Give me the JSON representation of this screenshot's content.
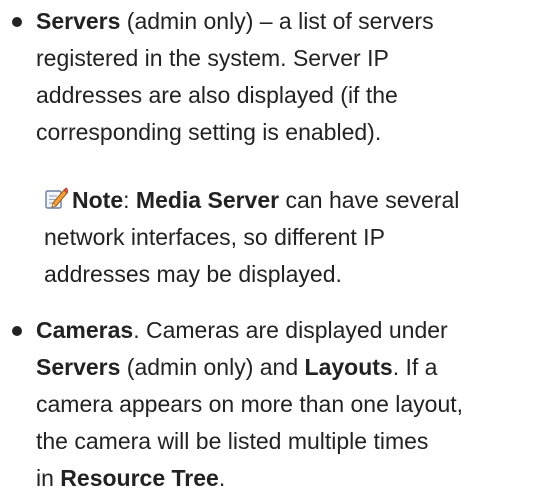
{
  "item_servers": {
    "term": "Servers",
    "line1_rest": " (admin only) – a list of servers",
    "line2": "registered in the system. Server IP",
    "line3": "addresses are also displayed (if the",
    "line4": "corresponding setting is enabled)."
  },
  "note": {
    "icon": "pencil-note-icon",
    "label": "Note",
    "sep": ": ",
    "term": "Media Server",
    "line1_rest": " can have several",
    "line2": "network interfaces, so different IP",
    "line3": "addresses may be displayed."
  },
  "item_cameras": {
    "term": "Cameras",
    "line1_rest": ". Cameras are displayed under",
    "servers_term": "Servers",
    "line2_mid": " (admin only) and ",
    "layouts_term": "Layouts",
    "line2_end": ". If a",
    "line3": "camera appears on more than one layout,",
    "line4": "the camera will be listed multiple times",
    "line5_start": "in ",
    "resource_tree_term": "Resource Tree",
    "line5_end": "."
  }
}
